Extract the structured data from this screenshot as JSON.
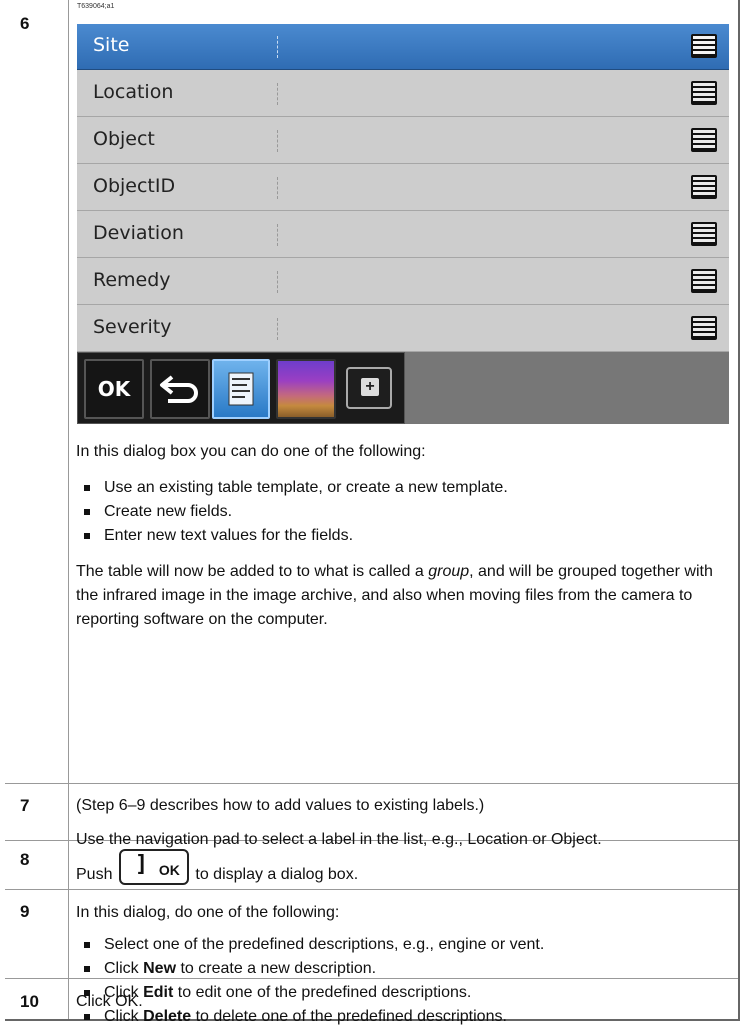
{
  "figure_id": "T639064;a1",
  "steps": [
    {
      "number": "6"
    },
    {
      "number": "7"
    },
    {
      "number": "8"
    },
    {
      "number": "9"
    },
    {
      "number": "10"
    }
  ],
  "screen": {
    "rows": [
      {
        "label": "Site",
        "selected": true
      },
      {
        "label": "Location"
      },
      {
        "label": "Object"
      },
      {
        "label": "ObjectID"
      },
      {
        "label": "Deviation"
      },
      {
        "label": "Remedy"
      },
      {
        "label": "Severity"
      }
    ],
    "toolbar": {
      "ok_label": "OK",
      "buttons": [
        "back-arrow-icon",
        "list-icon",
        "image-icon",
        "add-icon"
      ]
    },
    "colors": {
      "selected_row": "#3a7cc6",
      "list_bg": "#cdcdcd",
      "toolbar_bg": "#1b1b1b"
    }
  },
  "step6": {
    "intro": "In this dialog box you can do one of the following:",
    "bullets": [
      "Use an existing table template, or create a new template.",
      "Create new fields.",
      "Enter new text values for the fields."
    ],
    "para_before_italic": "The table will now be added to to what is called a ",
    "para_italic": "group",
    "para_after_italic": ", and will be grouped together with the infrared image in the image archive, and also when moving files from the camera to reporting software on the computer."
  },
  "step7": {
    "line1": "(Step 6–9 describes how to add values to existing labels.)",
    "line2": "Use the navigation pad to select a label in the list, e.g., Location or Object."
  },
  "step8": {
    "push": "Push",
    "key_label": "OK",
    "after": "to display a dialog box."
  },
  "step9": {
    "intro": "In this dialog, do one of the following:",
    "b1": "Select one of the predefined descriptions, e.g., engine or vent.",
    "b2_pre": "Click ",
    "b2_bold": "New",
    "b2_post": " to create a new description.",
    "b3_pre": "Click ",
    "b3_bold": "Edit",
    "b3_post": " to edit one of the predefined descriptions.",
    "b4_pre": "Click ",
    "b4_bold": "Delete",
    "b4_post": " to delete one of the predefined descriptions."
  },
  "step10": {
    "text": "Click OK."
  }
}
